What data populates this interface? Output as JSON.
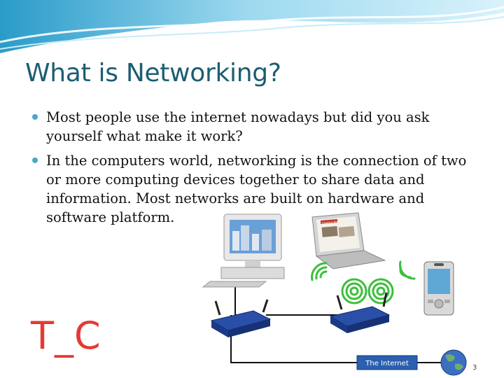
{
  "slide": {
    "title": "What is Networking?",
    "bullets": [
      "Most people use the internet nowadays but did you ask yourself what make it work?",
      "In the computers world, networking is the connection of two or more computing devices together to share data and information. Most networks are built on hardware and software platform."
    ],
    "logo_text": "T_C",
    "page_number": "3"
  },
  "diagram": {
    "internet_label": "The Internet",
    "laptop_screen_text": "Breaking News"
  },
  "colors": {
    "title": "#1b5e72",
    "bullet_dot": "#4aa8c8",
    "logo": "#e53935",
    "wave": "#7fc8e2",
    "router": "#2a4fa8",
    "wifi": "#3bbf3b"
  }
}
